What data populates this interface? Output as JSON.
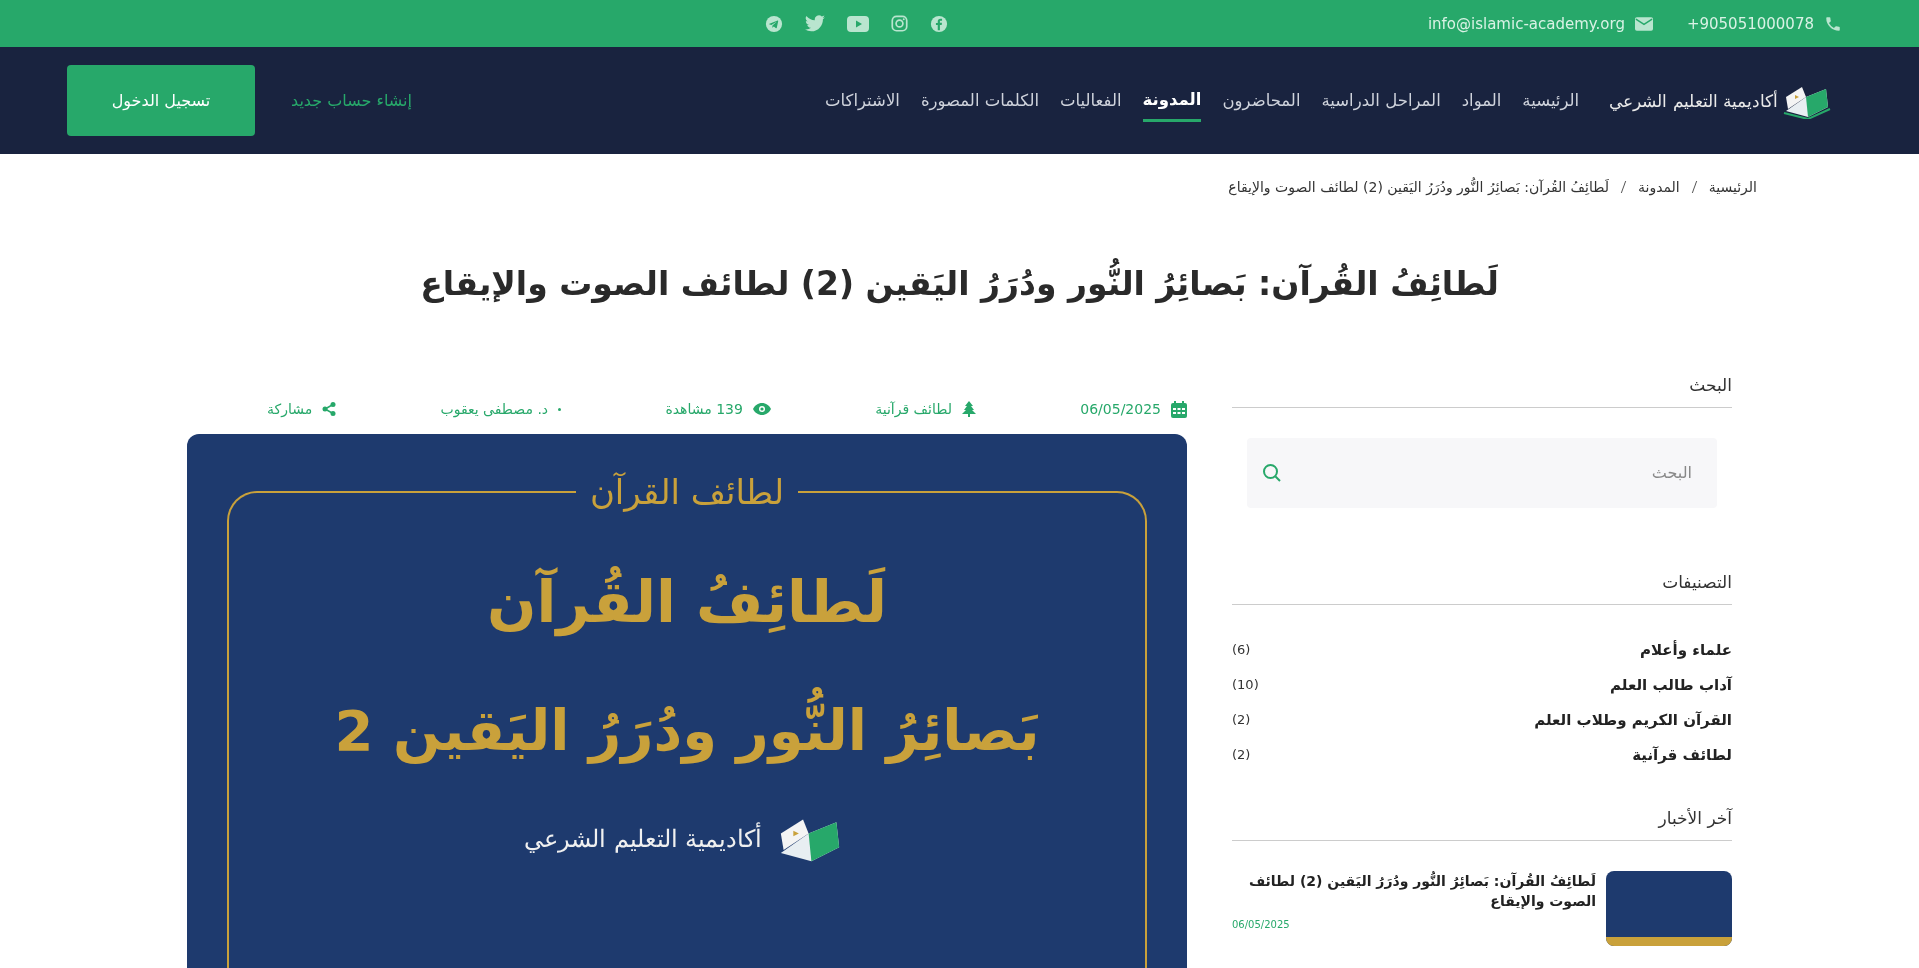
{
  "top_bar": {
    "phone": "+905051000078",
    "email": "info@islamic-academy.org"
  },
  "nav": {
    "logo_text": "أكاديمية التعليم الشرعي",
    "items": [
      {
        "label": "الرئيسية",
        "selected": false
      },
      {
        "label": "المواد",
        "selected": false
      },
      {
        "label": "المراحل الدراسية",
        "selected": false
      },
      {
        "label": "المحاضرون",
        "selected": false
      },
      {
        "label": "المدونة",
        "selected": true
      },
      {
        "label": "الفعاليات",
        "selected": false
      },
      {
        "label": "الكلمات المصورة",
        "selected": false
      },
      {
        "label": "الاشتراكات",
        "selected": false
      }
    ],
    "register_link": "إنشاء حساب جديد",
    "login_button": "تسجيل الدخول"
  },
  "breadcrumb": [
    "الرئيسية",
    "المدونة",
    "لَطائِفُ القُرآن: بَصائِرُ النُّور ودُرَرُ اليَقين (2) لطائف الصوت والإيقاع"
  ],
  "title": "لَطائِفُ القُرآن: بَصائِرُ النُّور ودُرَرُ اليَقين (2) لطائف الصوت والإيقاع",
  "meta": {
    "date": "06/05/2025",
    "category": "لطائف قرآنية",
    "views": "139 مشاهدة",
    "author": "د. مصطفى يعقوب",
    "share": "مشاركة"
  },
  "banner": {
    "overline": "لطائف القرآن",
    "title": "لَطائِفُ القُرآن",
    "subtitle": "بَصائِرُ النُّور ودُرَرُ اليَقين 2",
    "logo_text": "أكاديمية التعليم الشرعي"
  },
  "sidebar": {
    "search": {
      "heading": "البحث",
      "placeholder": "البحث"
    },
    "categories": {
      "heading": "التصنيفات",
      "items": [
        {
          "name": "علماء وأعلام",
          "count": "(6)"
        },
        {
          "name": "آداب طالب العلم",
          "count": "(10)"
        },
        {
          "name": "القرآن الكريم وطلاب العلم",
          "count": "(2)"
        },
        {
          "name": "لطائف قرآنية",
          "count": "(2)"
        }
      ]
    },
    "latest": {
      "heading": "آخر الأخبار",
      "items": [
        {
          "title": "لَطائِفُ القُرآن: بَصائِرُ النُّور ودُرَرُ اليَقين (2) لطائف الصوت والإيقاع",
          "date": "06/05/2025"
        }
      ]
    }
  }
}
